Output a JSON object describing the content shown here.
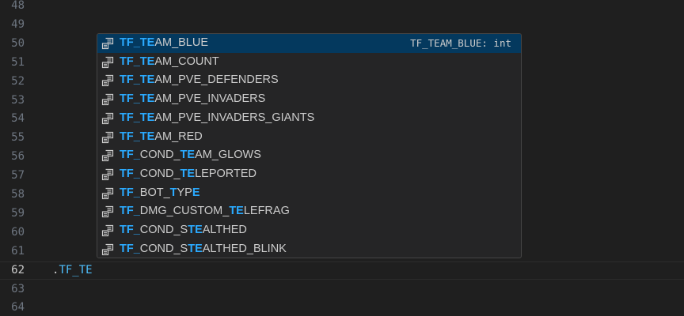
{
  "editor": {
    "lines": [
      {
        "number": "48",
        "text": ""
      },
      {
        "number": "49",
        "text": ""
      },
      {
        "number": "50",
        "text": ""
      },
      {
        "number": "51",
        "text": ""
      },
      {
        "number": "52",
        "text": ""
      },
      {
        "number": "53",
        "text": ""
      },
      {
        "number": "54",
        "text": ""
      },
      {
        "number": "55",
        "text": ""
      },
      {
        "number": "56",
        "text": ""
      },
      {
        "number": "57",
        "text": ""
      },
      {
        "number": "58",
        "text": ""
      },
      {
        "number": "59",
        "text": ""
      },
      {
        "number": "60",
        "text": ""
      },
      {
        "number": "61",
        "text": ""
      },
      {
        "number": "62",
        "dot": ".",
        "text": "TF_TE",
        "current": true
      },
      {
        "number": "63",
        "text": ""
      },
      {
        "number": "64",
        "text": ""
      }
    ]
  },
  "suggest": {
    "icon": "enum-member-icon",
    "colors": {
      "highlight": "#2aaaff",
      "selected_bg": "#04395e"
    },
    "items": [
      {
        "label": [
          "TF_TE",
          "AM_BLUE"
        ],
        "hl": [
          true,
          false
        ],
        "detail": "TF_TEAM_BLUE: int",
        "selected": true
      },
      {
        "label": [
          "TF_TE",
          "AM_COUNT"
        ],
        "hl": [
          true,
          false
        ]
      },
      {
        "label": [
          "TF_TE",
          "AM_PVE_DEFENDERS"
        ],
        "hl": [
          true,
          false
        ]
      },
      {
        "label": [
          "TF_TE",
          "AM_PVE_INVADERS"
        ],
        "hl": [
          true,
          false
        ]
      },
      {
        "label": [
          "TF_TE",
          "AM_PVE_INVADERS_GIANTS"
        ],
        "hl": [
          true,
          false
        ]
      },
      {
        "label": [
          "TF_TE",
          "AM_RED"
        ],
        "hl": [
          true,
          false
        ]
      },
      {
        "label": [
          "TF_",
          "COND_",
          "TE",
          "AM_GLOWS"
        ],
        "hl": [
          true,
          false,
          true,
          false
        ]
      },
      {
        "label": [
          "TF_",
          "COND_",
          "TE",
          "LEPORTED"
        ],
        "hl": [
          true,
          false,
          true,
          false
        ]
      },
      {
        "label": [
          "TF_",
          "BOT_",
          "T",
          "YP",
          "E"
        ],
        "hl": [
          true,
          false,
          true,
          false,
          true
        ]
      },
      {
        "label": [
          "TF_",
          "DMG_CUSTOM_",
          "TE",
          "LEFRAG"
        ],
        "hl": [
          true,
          false,
          true,
          false
        ]
      },
      {
        "label": [
          "TF_",
          "COND_S",
          "TE",
          "ALTHED"
        ],
        "hl": [
          true,
          false,
          true,
          false
        ]
      },
      {
        "label": [
          "TF_",
          "COND_S",
          "TE",
          "ALTHED_BLINK"
        ],
        "hl": [
          true,
          false,
          true,
          false
        ]
      }
    ]
  }
}
